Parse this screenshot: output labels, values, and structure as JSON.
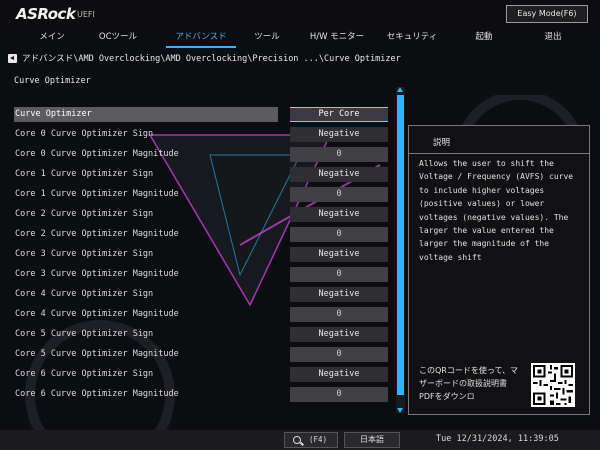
{
  "header": {
    "brand": "ASRock",
    "brand_suffix": "UEFI",
    "easy_mode_label": "Easy Mode(F6)"
  },
  "menu": {
    "items": [
      {
        "label": "メイン"
      },
      {
        "label": "OCツール"
      },
      {
        "label": "アドバンスド"
      },
      {
        "label": "ツール"
      },
      {
        "label": "H/W モニター"
      },
      {
        "label": "セキュリティ"
      },
      {
        "label": "起動"
      },
      {
        "label": "退出"
      }
    ],
    "active_index": 2
  },
  "breadcrumb": "アドバンスド\\AMD Overclocking\\AMD Overclocking\\Precision ...\\Curve Optimizer",
  "page_title": "Curve Optimizer",
  "settings": [
    {
      "label": "Curve Optimizer",
      "value": "Per Core"
    },
    {
      "label": "Core 0 Curve Optimizer Sign",
      "value": "Negative"
    },
    {
      "label": "Core 0 Curve Optimizer Magnitude",
      "value": "0"
    },
    {
      "label": "Core 1 Curve Optimizer Sign",
      "value": "Negative"
    },
    {
      "label": "Core 1 Curve Optimizer Magnitude",
      "value": "0"
    },
    {
      "label": "Core 2 Curve Optimizer Sign",
      "value": "Negative"
    },
    {
      "label": "Core 2 Curve Optimizer Magnitude",
      "value": "0"
    },
    {
      "label": "Core 3 Curve Optimizer Sign",
      "value": "Negative"
    },
    {
      "label": "Core 3 Curve Optimizer Magnitude",
      "value": "0"
    },
    {
      "label": "Core 4 Curve Optimizer Sign",
      "value": "Negative"
    },
    {
      "label": "Core 4 Curve Optimizer Magnitude",
      "value": "0"
    },
    {
      "label": "Core 5 Curve Optimizer Sign",
      "value": "Negative"
    },
    {
      "label": "Core 5 Curve Optimizer Magnitude",
      "value": "0"
    },
    {
      "label": "Core 6 Curve Optimizer Sign",
      "value": "Negative"
    },
    {
      "label": "Core 6 Curve Optimizer Magnitude",
      "value": "0"
    }
  ],
  "description": {
    "title": "説明",
    "text": "Allows the user to shift the Voltage / Frequency (AVFS) curve to include higher voltages (positive values) or lower voltages (negative values). The larger the value entered the larger the magnitude of the voltage shift",
    "qr_text": "このQRコードを使って、マザーボードの取扱説明書PDFをダウンロ"
  },
  "footer": {
    "search_key": "(F4)",
    "language": "日本語",
    "datetime": "Tue 12/31/2024, 11:39:05"
  },
  "colors": {
    "accent": "#34b4ff",
    "selected_row": "#5b5b60",
    "value_box": "#2f2f33"
  }
}
